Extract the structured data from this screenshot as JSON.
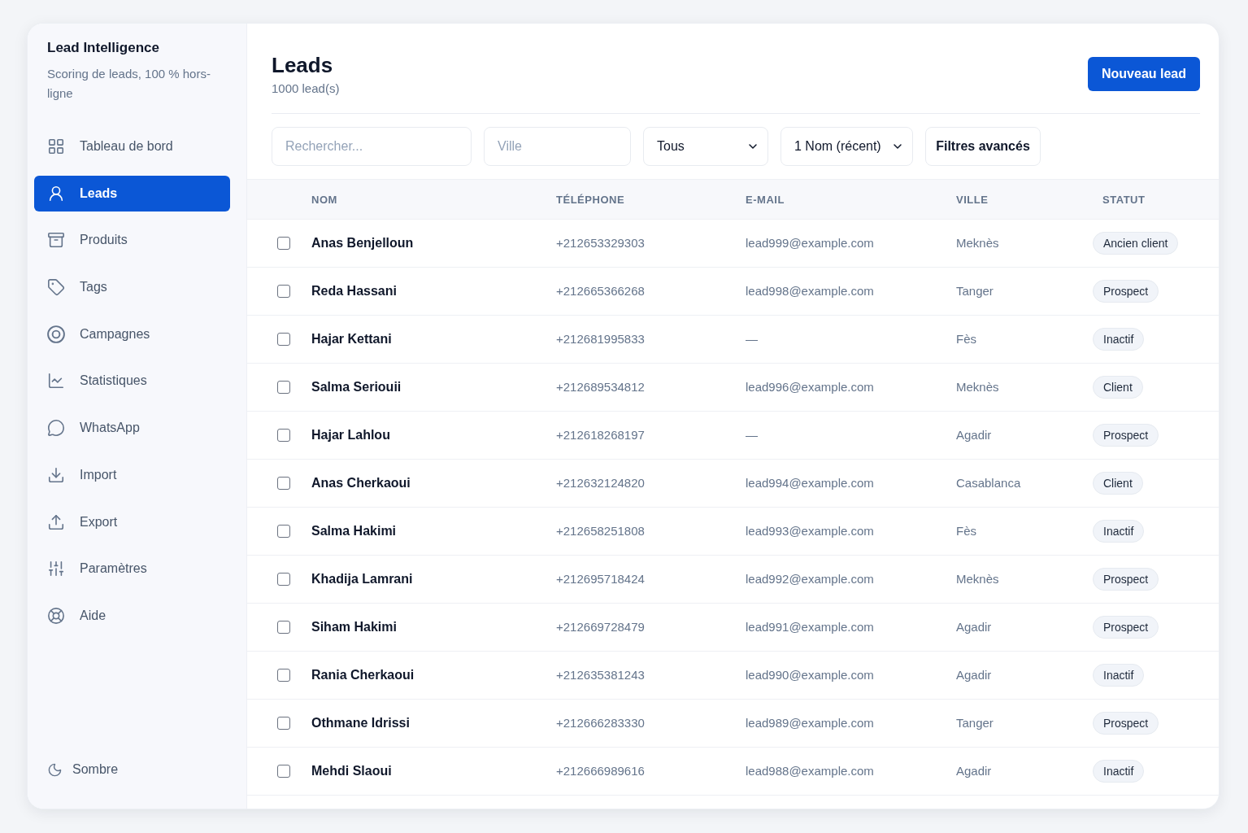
{
  "sidebar": {
    "title": "Lead Intelligence",
    "subtitle": "Scoring de leads, 100 % hors-ligne",
    "items": [
      {
        "label": "Tableau de bord",
        "selected": false
      },
      {
        "label": "Leads",
        "selected": true
      },
      {
        "label": "Produits",
        "selected": false
      },
      {
        "label": "Tags",
        "selected": false
      },
      {
        "label": "Campagnes",
        "selected": false
      },
      {
        "label": "Statistiques",
        "selected": false
      },
      {
        "label": "WhatsApp",
        "selected": false
      },
      {
        "label": "Import",
        "selected": false
      },
      {
        "label": "Export",
        "selected": false
      },
      {
        "label": "Paramètres",
        "selected": false
      },
      {
        "label": "Aide",
        "selected": false
      }
    ],
    "theme_toggle": {
      "label": "Sombre"
    }
  },
  "header": {
    "title": "Leads",
    "count": "1000 lead(s)",
    "primary_button": "Nouveau lead"
  },
  "filters": {
    "search": {
      "placeholder": "Rechercher..."
    },
    "city": {
      "placeholder": "Ville"
    },
    "status_select": {
      "value": "Tous"
    },
    "sort_select": {
      "value": "1 Nom (récent)"
    },
    "advanced_button": "Filtres avancés"
  },
  "table": {
    "columns": [
      "NOM",
      "TÉLÉPHONE",
      "E-MAIL",
      "VILLE",
      "STATUT"
    ],
    "rows": [
      {
        "checked": false,
        "name": "Anas Benjelloun",
        "phone": "+212653329303",
        "email": "lead999@example.com",
        "city": "Meknès",
        "status": "Ancien client"
      },
      {
        "checked": false,
        "name": "Reda Hassani",
        "phone": "+212665366268",
        "email": "lead998@example.com",
        "city": "Tanger",
        "status": "Prospect"
      },
      {
        "checked": false,
        "name": "Hajar Kettani",
        "phone": "+212681995833",
        "email": "—",
        "city": "Fès",
        "status": "Inactif"
      },
      {
        "checked": false,
        "name": "Salma Seriouii",
        "phone": "+212689534812",
        "email": "lead996@example.com",
        "city": "Meknès",
        "status": "Client"
      },
      {
        "checked": false,
        "name": "Hajar Lahlou",
        "phone": "+212618268197",
        "email": "—",
        "city": "Agadir",
        "status": "Prospect"
      },
      {
        "checked": false,
        "name": "Anas Cherkaoui",
        "phone": "+212632124820",
        "email": "lead994@example.com",
        "city": "Casablanca",
        "status": "Client"
      },
      {
        "checked": false,
        "name": "Salma Hakimi",
        "phone": "+212658251808",
        "email": "lead993@example.com",
        "city": "Fès",
        "status": "Inactif"
      },
      {
        "checked": false,
        "name": "Khadija Lamrani",
        "phone": "+212695718424",
        "email": "lead992@example.com",
        "city": "Meknès",
        "status": "Prospect"
      },
      {
        "checked": false,
        "name": "Siham Hakimi",
        "phone": "+212669728479",
        "email": "lead991@example.com",
        "city": "Agadir",
        "status": "Prospect"
      },
      {
        "checked": false,
        "name": "Rania Cherkaoui",
        "phone": "+212635381243",
        "email": "lead990@example.com",
        "city": "Agadir",
        "status": "Inactif"
      },
      {
        "checked": false,
        "name": "Othmane Idrissi",
        "phone": "+212666283330",
        "email": "lead989@example.com",
        "city": "Tanger",
        "status": "Prospect"
      },
      {
        "checked": false,
        "name": "Mehdi Slaoui",
        "phone": "+212666989616",
        "email": "lead988@example.com",
        "city": "Agadir",
        "status": "Inactif"
      }
    ]
  }
}
